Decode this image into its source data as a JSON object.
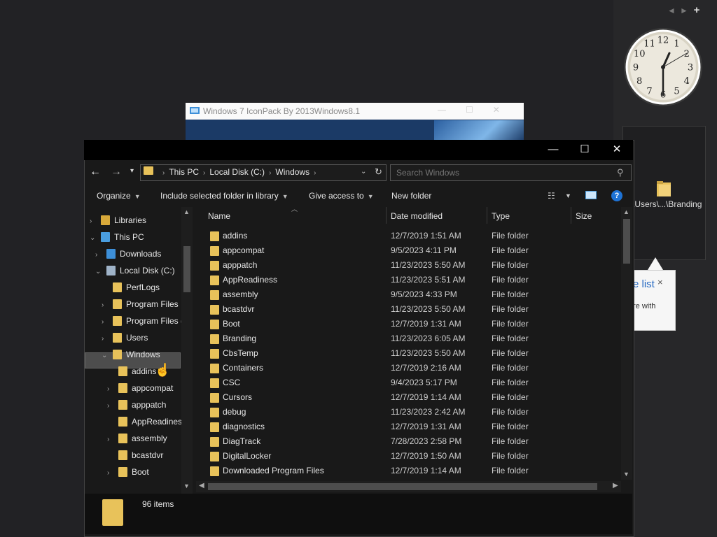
{
  "gadgets": {
    "nav": {
      "prev": "◄",
      "next": "►",
      "add": "+"
    },
    "clock": {
      "numbers": [
        "12",
        "1",
        "2",
        "3",
        "4",
        "5",
        "6",
        "7",
        "8",
        "9",
        "10",
        "11"
      ]
    },
    "folder_label": "\\Users\\...\\Branding",
    "tooltip": {
      "link": "e list",
      "text": "re with",
      "close": "×"
    }
  },
  "back_window": {
    "title": "Windows 7 IconPack By 2013Windows8.1"
  },
  "explorer": {
    "window_controls": {
      "minimize": "—",
      "maximize": "☐",
      "close": "✕"
    },
    "address": {
      "crumbs": [
        "This PC",
        "Local Disk (C:)",
        "Windows"
      ]
    },
    "search": {
      "placeholder": "Search Windows"
    },
    "commands": {
      "organize": "Organize",
      "include": "Include selected folder in library",
      "share": "Give access to",
      "new_folder": "New folder"
    },
    "nav_pane": [
      {
        "label": "Libraries",
        "indent": 0,
        "chevron": "›",
        "icon": "library"
      },
      {
        "label": "This PC",
        "indent": 0,
        "chevron": "⌄",
        "icon": "pc"
      },
      {
        "label": "Downloads",
        "indent": 1,
        "chevron": "›",
        "icon": "download"
      },
      {
        "label": "Local Disk (C:)",
        "indent": 1,
        "chevron": "⌄",
        "icon": "disk"
      },
      {
        "label": "PerfLogs",
        "indent": 2,
        "chevron": "",
        "icon": "folder"
      },
      {
        "label": "Program Files",
        "indent": 2,
        "chevron": "›",
        "icon": "folder"
      },
      {
        "label": "Program Files (",
        "indent": 2,
        "chevron": "›",
        "icon": "folder"
      },
      {
        "label": "Users",
        "indent": 2,
        "chevron": "›",
        "icon": "folder"
      },
      {
        "label": "Windows",
        "indent": 2,
        "chevron": "⌄",
        "icon": "folder",
        "selected": true
      },
      {
        "label": "addins",
        "indent": 3,
        "chevron": "",
        "icon": "folder"
      },
      {
        "label": "appcompat",
        "indent": 3,
        "chevron": "›",
        "icon": "folder"
      },
      {
        "label": "apppatch",
        "indent": 3,
        "chevron": "›",
        "icon": "folder"
      },
      {
        "label": "AppReadines",
        "indent": 3,
        "chevron": "",
        "icon": "folder"
      },
      {
        "label": "assembly",
        "indent": 3,
        "chevron": "›",
        "icon": "folder"
      },
      {
        "label": "bcastdvr",
        "indent": 3,
        "chevron": "",
        "icon": "folder"
      },
      {
        "label": "Boot",
        "indent": 3,
        "chevron": "›",
        "icon": "folder"
      }
    ],
    "columns": {
      "name": "Name",
      "date": "Date modified",
      "type": "Type",
      "size": "Size"
    },
    "files": [
      {
        "name": "addins",
        "date": "12/7/2019 1:51 AM",
        "type": "File folder"
      },
      {
        "name": "appcompat",
        "date": "9/5/2023 4:11 PM",
        "type": "File folder"
      },
      {
        "name": "apppatch",
        "date": "11/23/2023 5:50 AM",
        "type": "File folder"
      },
      {
        "name": "AppReadiness",
        "date": "11/23/2023 5:51 AM",
        "type": "File folder"
      },
      {
        "name": "assembly",
        "date": "9/5/2023 4:33 PM",
        "type": "File folder"
      },
      {
        "name": "bcastdvr",
        "date": "11/23/2023 5:50 AM",
        "type": "File folder"
      },
      {
        "name": "Boot",
        "date": "12/7/2019 1:31 AM",
        "type": "File folder"
      },
      {
        "name": "Branding",
        "date": "11/23/2023 6:05 AM",
        "type": "File folder"
      },
      {
        "name": "CbsTemp",
        "date": "11/23/2023 5:50 AM",
        "type": "File folder"
      },
      {
        "name": "Containers",
        "date": "12/7/2019 2:16 AM",
        "type": "File folder"
      },
      {
        "name": "CSC",
        "date": "9/4/2023 5:17 PM",
        "type": "File folder"
      },
      {
        "name": "Cursors",
        "date": "12/7/2019 1:14 AM",
        "type": "File folder"
      },
      {
        "name": "debug",
        "date": "11/23/2023 2:42 AM",
        "type": "File folder"
      },
      {
        "name": "diagnostics",
        "date": "12/7/2019 1:31 AM",
        "type": "File folder"
      },
      {
        "name": "DiagTrack",
        "date": "7/28/2023 2:58 PM",
        "type": "File folder"
      },
      {
        "name": "DigitalLocker",
        "date": "12/7/2019 1:50 AM",
        "type": "File folder"
      },
      {
        "name": "Downloaded Program Files",
        "date": "12/7/2019 1:14 AM",
        "type": "File folder"
      }
    ],
    "status": {
      "item_count": "96 items"
    }
  },
  "colors": {
    "folder": "#e8c25a",
    "background": "#222225",
    "window": "#191919",
    "selection": "#4d4d4d",
    "accent": "#1e73d6"
  }
}
